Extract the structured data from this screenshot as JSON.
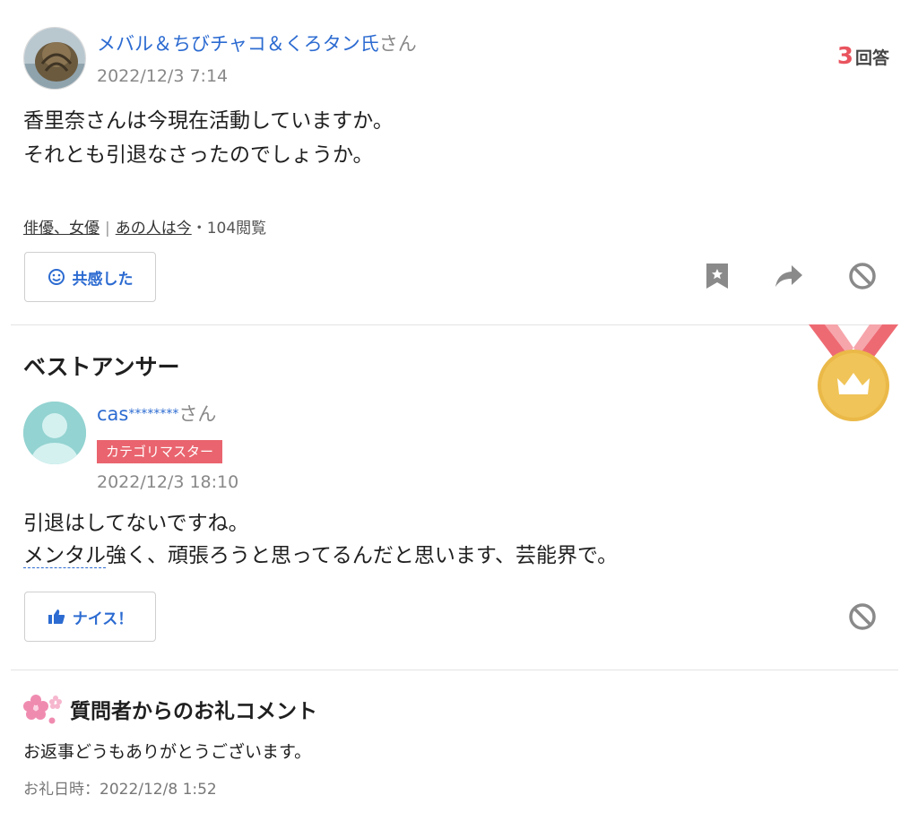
{
  "question": {
    "user_name": "メバル＆ちびチャコ＆くろタン氏",
    "user_suffix": "さん",
    "date": "2022/12/3 7:14",
    "answer_count": "3",
    "answer_count_label": "回答",
    "body_line1": "香里奈さんは今現在活動していますか。",
    "body_line2": "それとも引退なさったのでしょうか。",
    "category": "俳優、女優",
    "tag": "あの人は今",
    "views": "・104閲覧",
    "empathy_label": "共感した"
  },
  "best_answer": {
    "title": "ベストアンサー",
    "user_name": "cas",
    "user_masked": "********",
    "user_suffix": "さん",
    "badge": "カテゴリマスター",
    "date": "2022/12/3 18:10",
    "body_line1": "引退はしてないですね。",
    "body_line2_link": "メンタル",
    "body_line2_rest": "強く、頑張ろうと思ってるんだと思います、芸能界で。",
    "nice_label": "ナイス！"
  },
  "thanks": {
    "title": "質問者からのお礼コメント",
    "body": "お返事どうもありがとうございます。",
    "date": "お礼日時：2022/12/8 1:52"
  },
  "colors": {
    "accent_blue": "#2c6bd1",
    "count_red": "#e9545e",
    "badge_red": "#e9646e"
  },
  "icons": [
    "smile-icon",
    "bookmark-icon",
    "share-icon",
    "block-icon",
    "thumbs-up-icon",
    "medal-icon",
    "sakura-icon"
  ]
}
